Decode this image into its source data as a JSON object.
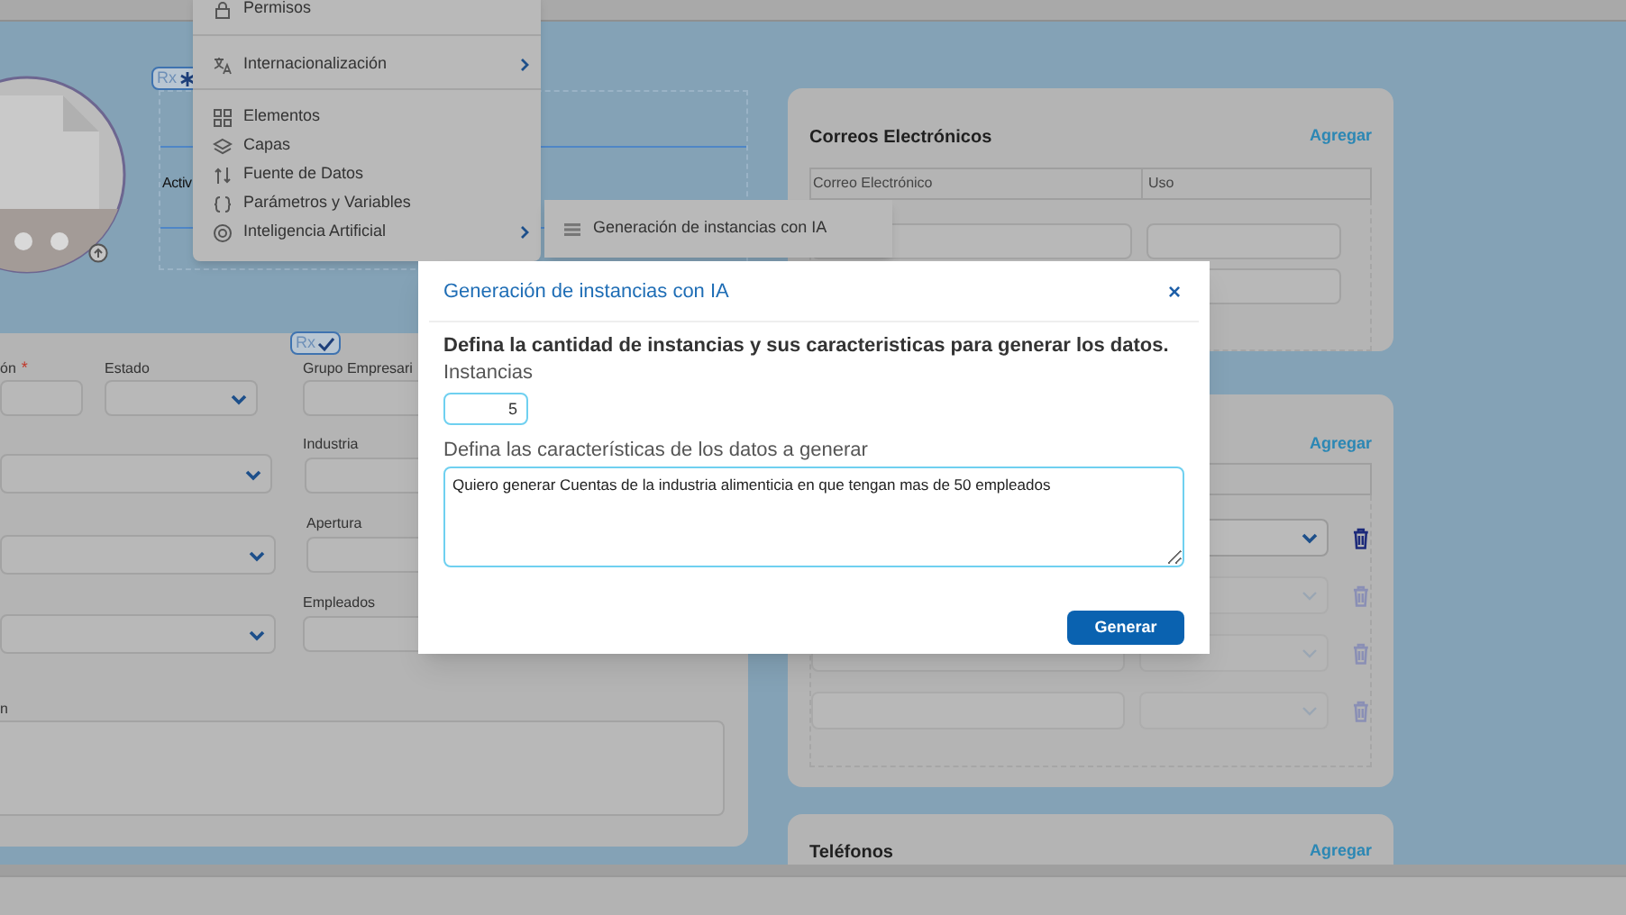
{
  "context_menu": {
    "groups": [
      [
        {
          "label": "Permisos",
          "submenu": false
        }
      ],
      [
        {
          "label": "Internacionalización",
          "submenu": true
        }
      ],
      [
        {
          "label": "Elementos",
          "submenu": false
        },
        {
          "label": "Capas",
          "submenu": false
        },
        {
          "label": "Fuente de Datos",
          "submenu": false
        },
        {
          "label": "Parámetros y Variables",
          "submenu": false
        },
        {
          "label": "Inteligencia Artificial",
          "submenu": true
        }
      ]
    ]
  },
  "submenu": {
    "items": [
      {
        "label": "Generación de instancias con IA"
      }
    ]
  },
  "rx_badges": [
    {
      "text": "Rx",
      "kind": "asterisk"
    },
    {
      "text": "Rx",
      "kind": "check"
    }
  ],
  "profile_panel": {
    "label": "Activ"
  },
  "form_card": {
    "fields": [
      {
        "label": "ón",
        "required_mark": "*",
        "kind": "input"
      },
      {
        "label": "Estado",
        "kind": "select"
      },
      {
        "label": "Grupo Empresari",
        "kind": "input"
      },
      {
        "kind": "select"
      },
      {
        "label": "Industria",
        "kind": "input"
      },
      {
        "kind": "select"
      },
      {
        "label": "Apertura",
        "kind": "input"
      },
      {
        "kind": "select"
      },
      {
        "label": "Empleados",
        "kind": "input"
      },
      {
        "label": "n",
        "kind": "textarea"
      }
    ]
  },
  "email_card": {
    "title": "Correos Electrónicos",
    "action": "Agregar",
    "columns": [
      "Correo Electrónico",
      "Uso"
    ]
  },
  "second_card": {
    "action": "Agregar",
    "rows": [
      {
        "disabled": false
      },
      {
        "disabled": true
      },
      {
        "disabled": true
      },
      {
        "disabled": true
      }
    ]
  },
  "phones_card": {
    "title": "Teléfonos",
    "action": "Agregar"
  },
  "dialog": {
    "title": "Generación de instancias con IA",
    "close": "×",
    "heading": "Defina la cantidad de instancias y sus caracteristicas para generar los datos.",
    "fields": [
      {
        "kind": "number",
        "label": "Instancias",
        "value": "5"
      },
      {
        "kind": "textarea",
        "label": "Defina las características de los datos a generar",
        "value": "Quiero generar Cuentas de la industria alimenticia en que tengan mas de 50 empleados"
      }
    ],
    "buttons": [
      "Generar"
    ]
  }
}
